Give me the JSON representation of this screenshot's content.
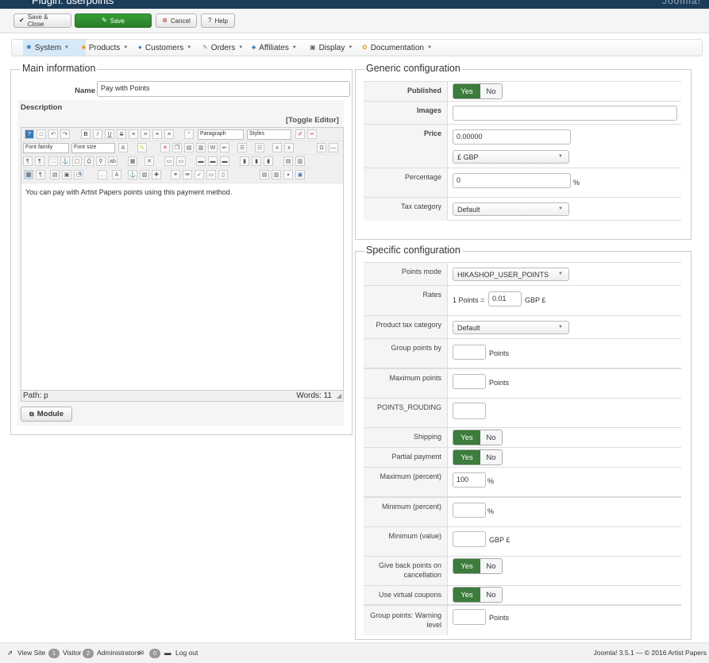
{
  "header": {
    "title": "Plugin: userpoints",
    "brand": "Joomla!"
  },
  "toolbar": {
    "save_close": "Save & Close",
    "save": "Save",
    "cancel": "Cancel",
    "help": "Help"
  },
  "menu": [
    "System",
    "Products",
    "Customers",
    "Orders",
    "Affiliates",
    "Display",
    "Documentation"
  ],
  "main": {
    "legend": "Main information",
    "name_label": "Name",
    "name_value": "Pay with Points",
    "description_label": "Description",
    "toggle_editor": "[Toggle Editor]",
    "editor": {
      "format": "Paragraph",
      "styles": "Styles",
      "font_family": "Font family",
      "font_size": "Font size",
      "content": "You can pay with Artist Papers points using this payment method.",
      "path": "Path: p",
      "words": "Words: 11"
    },
    "module_button": "Module"
  },
  "generic": {
    "legend": "Generic configuration",
    "published_label": "Published",
    "images_label": "Images",
    "price_label": "Price",
    "price_value": "0.00000",
    "currency": "£ GBP",
    "percentage_label": "Percentage",
    "percentage_value": "0",
    "percent_sign": "%",
    "tax_label": "Tax category",
    "tax_value": "Default"
  },
  "specific": {
    "legend": "Specific configuration",
    "points_mode_label": "Points mode",
    "points_mode_value": "HIKASHOP_USER_POINTS",
    "rates_label": "Rates",
    "rates_prefix": "1 Points =",
    "rates_value": "0.01",
    "rates_suffix": "GBP £",
    "product_tax_label": "Product tax category",
    "product_tax_value": "Default",
    "group_points_label": "Group points by",
    "points_unit": "Points",
    "max_points_label": "Maximum points",
    "rouding_label": "POINTS_ROUDING",
    "shipping_label": "Shipping",
    "partial_label": "Partial payment",
    "max_percent_label": "Maximum (percent)",
    "max_percent_value": "100",
    "min_percent_label": "Minimum (percent)",
    "min_value_label": "Minimum (value)",
    "min_value_unit": "GBP £",
    "give_back_label": "Give back points on cancellation",
    "virtual_coupons_label": "Use virtual coupons",
    "group_warning_label": "Group points: Warning level",
    "yes": "Yes",
    "no": "No"
  },
  "status": {
    "view_site": "View Site",
    "visitors_count": "1",
    "visitors": "Visitor",
    "admins_count": "2",
    "admins": "Administrators",
    "messages_count": "0",
    "logout": "Log out",
    "version": "Joomla! 3.5.1 — © 2016 Artist Papers"
  },
  "colors": {
    "header": "#1c3d5a",
    "green": "#3c7c3c",
    "menu_active": "#d6e9f8"
  }
}
